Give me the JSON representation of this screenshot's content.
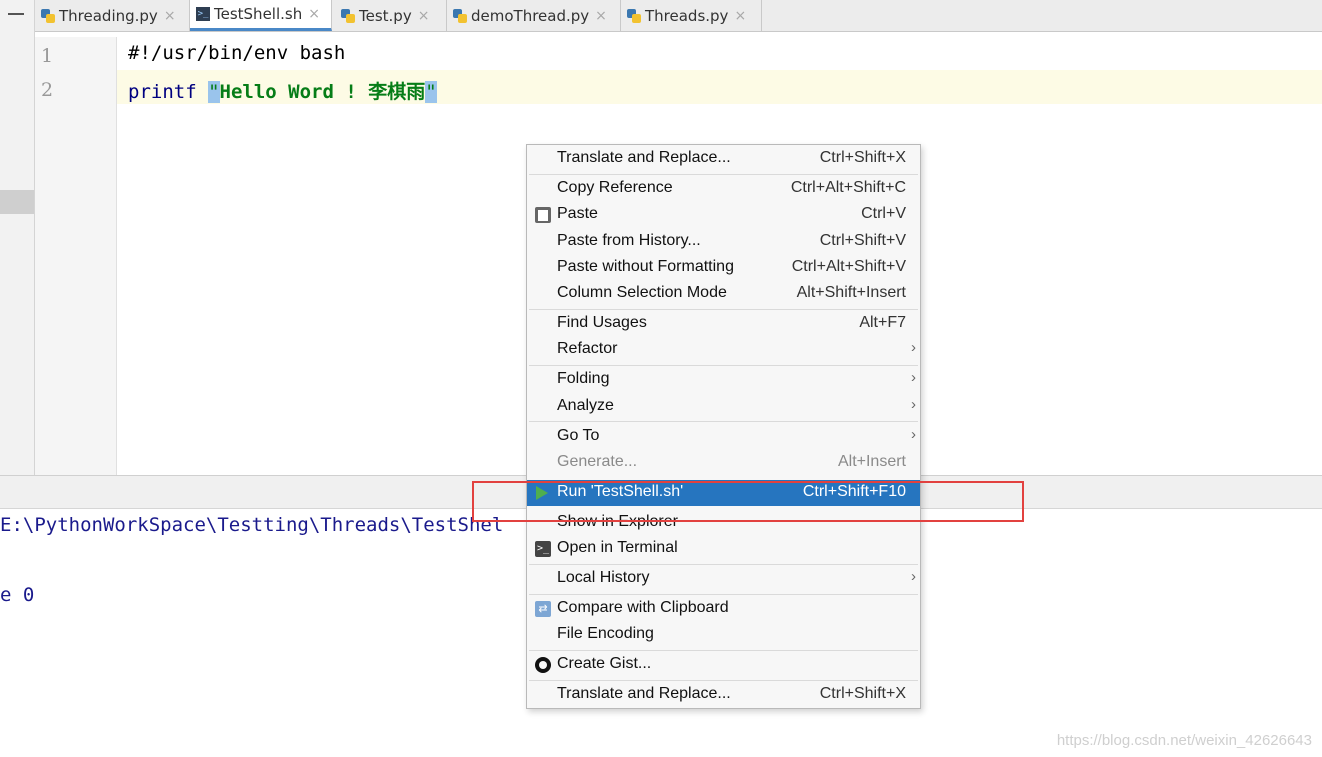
{
  "tabs": [
    {
      "label": "Threading.py",
      "icon": "python-file-icon",
      "active": false
    },
    {
      "label": "TestShell.sh",
      "icon": "shell-file-icon",
      "active": true
    },
    {
      "label": "Test.py",
      "icon": "python-file-icon",
      "active": false
    },
    {
      "label": "demoThread.py",
      "icon": "python-file-icon",
      "active": false
    },
    {
      "label": "Threads.py",
      "icon": "python-file-icon",
      "active": false
    }
  ],
  "tab_close": "×",
  "editor": {
    "line_numbers": [
      "1",
      "2"
    ],
    "line1": "#!/usr/bin/env bash",
    "line2_cmd": "printf",
    "quote_open": "\"",
    "line2_string": "Hello Word ! 李棋雨",
    "quote_close": "\""
  },
  "terminal": {
    "path_line": "E:\\PythonWorkSpace\\Testting\\Threads\\TestShel",
    "exit_line": "e 0"
  },
  "context_menu": {
    "items": [
      {
        "label": "Translate and Replace...",
        "shortcut": "Ctrl+Shift+X"
      },
      {
        "label": "Copy Reference",
        "shortcut": "Ctrl+Alt+Shift+C"
      },
      {
        "label": "Paste",
        "shortcut": "Ctrl+V",
        "icon": "clipboard-icon"
      },
      {
        "label": "Paste from History...",
        "shortcut": "Ctrl+Shift+V"
      },
      {
        "label": "Paste without Formatting",
        "shortcut": "Ctrl+Alt+Shift+V"
      },
      {
        "label": "Column Selection Mode",
        "shortcut": "Alt+Shift+Insert"
      },
      {
        "label": "Find Usages",
        "shortcut": "Alt+F7"
      },
      {
        "label": "Refactor",
        "submenu": true
      },
      {
        "label": "Folding",
        "submenu": true
      },
      {
        "label": "Analyze",
        "submenu": true
      },
      {
        "label": "Go To",
        "submenu": true
      },
      {
        "label": "Generate...",
        "shortcut": "Alt+Insert",
        "disabled": true
      },
      {
        "label": "Run 'TestShell.sh'",
        "shortcut": "Ctrl+Shift+F10",
        "icon": "run-icon",
        "selected": true
      },
      {
        "label": "Show in Explorer"
      },
      {
        "label": "Open in Terminal",
        "icon": "terminal-icon"
      },
      {
        "label": "Local History",
        "submenu": true
      },
      {
        "label": "Compare with Clipboard",
        "icon": "compare-icon"
      },
      {
        "label": "File Encoding"
      },
      {
        "label": "Create Gist...",
        "icon": "github-icon"
      },
      {
        "label": "Translate and Replace...",
        "shortcut": "Ctrl+Shift+X"
      }
    ],
    "submenu_arrow": "›"
  },
  "watermark": "https://blog.csdn.net/weixin_42626643",
  "colors": {
    "selection": "#2675bf",
    "highlight_box": "#e2413f",
    "string": "#067d17",
    "keyword": "#000080"
  }
}
